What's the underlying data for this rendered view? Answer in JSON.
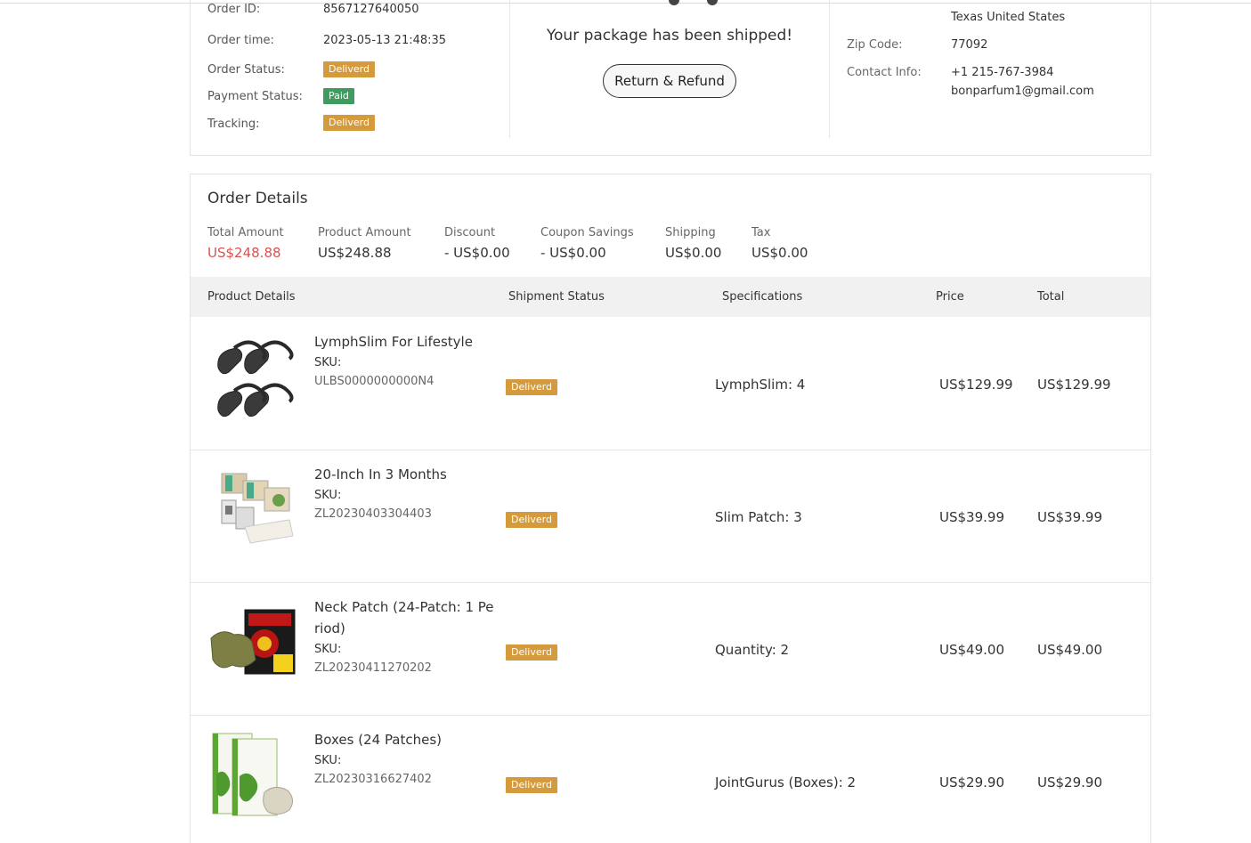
{
  "order_info": {
    "order_id_label": "Order ID:",
    "order_id": "8567127640050",
    "order_time_label": "Order time:",
    "order_time": "2023-05-13 21:48:35",
    "order_status_label": "Order Status:",
    "order_status": "Deliverd",
    "payment_status_label": "Payment Status:",
    "payment_status": "Paid",
    "tracking_label": "Tracking:",
    "tracking": "Deliverd"
  },
  "shipment": {
    "message": "Your package has been shipped!",
    "return_button": "Return & Refund"
  },
  "address": {
    "region": "Texas  United States",
    "zip_label": "Zip Code:",
    "zip": "77092",
    "contact_label": "Contact Info:",
    "phone": "+1 215-767-3984",
    "email": "bonparfum1@gmail.com"
  },
  "order_details": {
    "title": "Order Details",
    "amounts": [
      {
        "label": "Total Amount",
        "value": "US$248.88"
      },
      {
        "label": "Product Amount",
        "value": "US$248.88"
      },
      {
        "label": "Discount",
        "value": "- US$0.00"
      },
      {
        "label": "Coupon Savings",
        "value": "- US$0.00"
      },
      {
        "label": "Shipping",
        "value": "US$0.00"
      },
      {
        "label": "Tax",
        "value": "US$0.00"
      }
    ]
  },
  "table": {
    "headers": [
      "Product Details",
      "Shipment Status",
      "Specifications",
      "Price",
      "Total"
    ],
    "sku_label": "SKU:",
    "rows": [
      {
        "name": "LymphSlim For Lifestyle",
        "sku": "ULBS0000000000N4",
        "status": "Deliverd",
        "spec": "LymphSlim: 4",
        "price": "US$129.99",
        "total": "US$129.99",
        "image": "lymph-device-image"
      },
      {
        "name": "20-Inch In 3 Months",
        "sku": "ZL20230403304403",
        "status": "Deliverd",
        "spec": "Slim Patch: 3",
        "price": "US$39.99",
        "total": "US$39.99",
        "image": "slim-patch-image"
      },
      {
        "name": "Neck Patch (24-Patch: 1 Period)",
        "sku": "ZL20230411270202",
        "status": "Deliverd",
        "spec": "Quantity: 2",
        "price": "US$49.00",
        "total": "US$49.00",
        "image": "neck-patch-image"
      },
      {
        "name": "Boxes (24 Patches)",
        "sku": "ZL20230316627402",
        "status": "Deliverd",
        "spec": "JointGurus (Boxes): 2",
        "price": "US$29.90",
        "total": "US$29.90",
        "image": "pain-relief-patch-image"
      }
    ]
  },
  "colors": {
    "badge_orange": "#d49a3c",
    "badge_green": "#3f9b5f",
    "total_red": "#d9534f",
    "header_bg": "#f1f1f1"
  }
}
